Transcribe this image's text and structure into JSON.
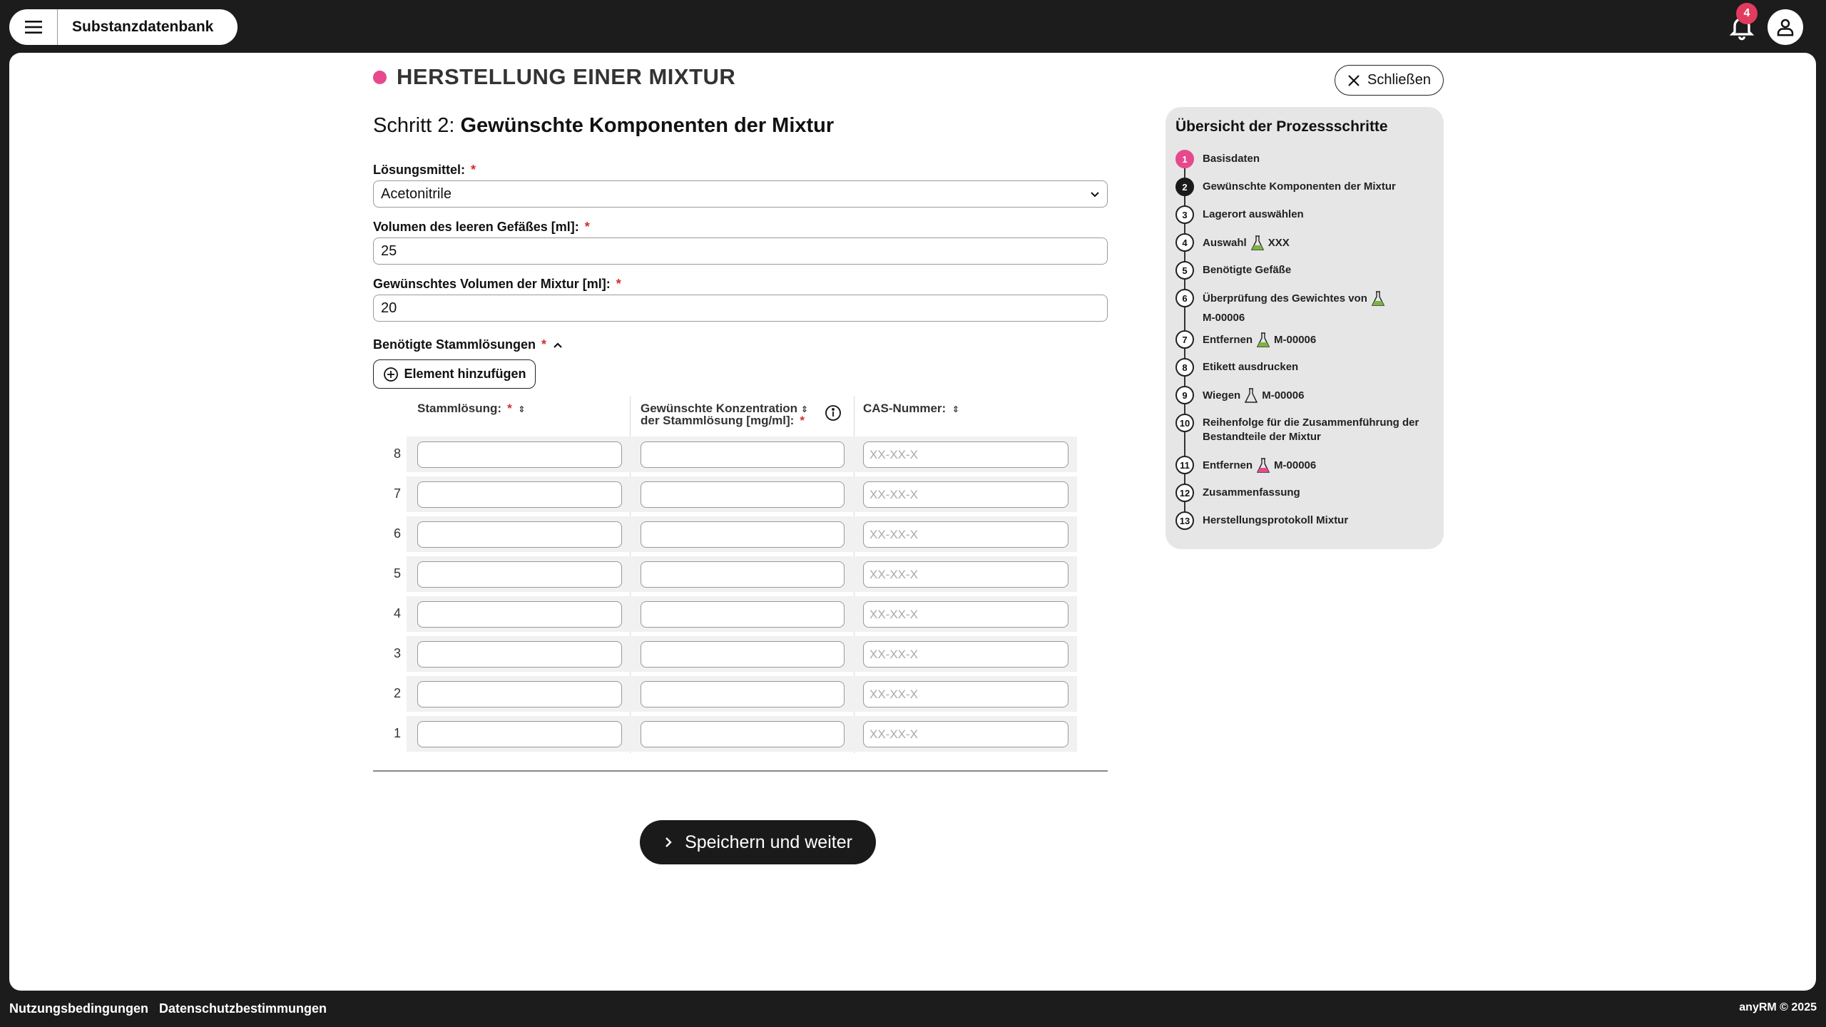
{
  "app": {
    "title": "Substanzdatenbank",
    "notification_count": "4"
  },
  "page": {
    "heading": "HERSTELLUNG EINER MIXTUR",
    "close_label": "Schließen",
    "step_prefix": "Schritt 2:",
    "step_title": "Gewünschte Komponenten der Mixtur"
  },
  "form": {
    "solvent_label": "Lösungsmittel:",
    "solvent_value": "Acetonitrile",
    "vessel_label": "Volumen des leeren Gefäßes [ml]:",
    "vessel_value": "25",
    "mix_label": "Gewünschtes Volumen der Mixtur [ml]:",
    "mix_value": "20",
    "required_mark": "*"
  },
  "stock": {
    "label": "Benötigte Stammlösungen",
    "add_label": "Element hinzufügen",
    "headers": {
      "col1": "Stammlösung:",
      "col2_line1": "Gewünschte Konzentration",
      "col2_line2": "der Stammlösung [mg/ml]:",
      "col3": "CAS-Nummer:"
    },
    "cas_placeholder": "XX-XX-X",
    "rows": [
      "8",
      "7",
      "6",
      "5",
      "4",
      "3",
      "2",
      "1"
    ]
  },
  "actions": {
    "save_label": "Speichern und weiter"
  },
  "sidebar": {
    "title": "Übersicht der Prozessschritte",
    "steps": [
      {
        "num": "1",
        "label": "Basisdaten"
      },
      {
        "num": "2",
        "label": "Gewünschte Komponenten der Mixtur"
      },
      {
        "num": "3",
        "label": "Lagerort auswählen"
      },
      {
        "num": "4",
        "label": "Auswahl",
        "tag": "XXX"
      },
      {
        "num": "5",
        "label": "Benötigte Gefäße"
      },
      {
        "num": "6",
        "label": "Überprüfung des Gewichtes von",
        "tag": "M-00006"
      },
      {
        "num": "7",
        "label": "Entfernen",
        "tag": "M-00006"
      },
      {
        "num": "8",
        "label": "Etikett ausdrucken"
      },
      {
        "num": "9",
        "label": "Wiegen",
        "tag": "M-00006"
      },
      {
        "num": "10",
        "label": "Reihenfolge für die Zusammenführung der Bestandteile der Mixtur"
      },
      {
        "num": "11",
        "label": "Entfernen",
        "tag": "M-00006"
      },
      {
        "num": "12",
        "label": "Zusammenfassung"
      },
      {
        "num": "13",
        "label": "Herstellungsprotokoll Mixtur"
      }
    ]
  },
  "footer": {
    "terms": "Nutzungsbedingungen",
    "privacy": "Datenschutzbestimmungen",
    "copyright": "anyRM © 2025"
  },
  "colors": {
    "accent_pink": "#e6498c",
    "flask_green": "#7cb342",
    "flask_pink": "#e6498c",
    "badge_red": "#e23b5d",
    "required_red": "#d32f2f"
  }
}
